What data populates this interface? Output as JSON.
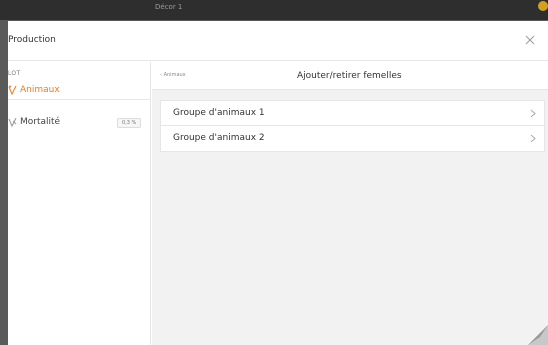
{
  "backdrop": {
    "title": "Décor 1",
    "accent_color": "#d4a020"
  },
  "modal": {
    "title": "Production"
  },
  "sidebar": {
    "section_label": "LOT",
    "items": [
      {
        "label": "Animaux",
        "icon": "animals-icon",
        "active": true
      },
      {
        "label": "Mortalité",
        "icon": "mortality-icon",
        "badge": "0,3 %"
      }
    ]
  },
  "main": {
    "back_label": "Animaux",
    "title": "Ajouter/retirer femelles",
    "list": [
      {
        "label": "Groupe d'animaux 1"
      },
      {
        "label": "Groupe d'animaux 2"
      }
    ]
  },
  "colors": {
    "accent": "#e67e22",
    "panel_background": "#f2f2f2",
    "divider": "#e6e6e6"
  }
}
